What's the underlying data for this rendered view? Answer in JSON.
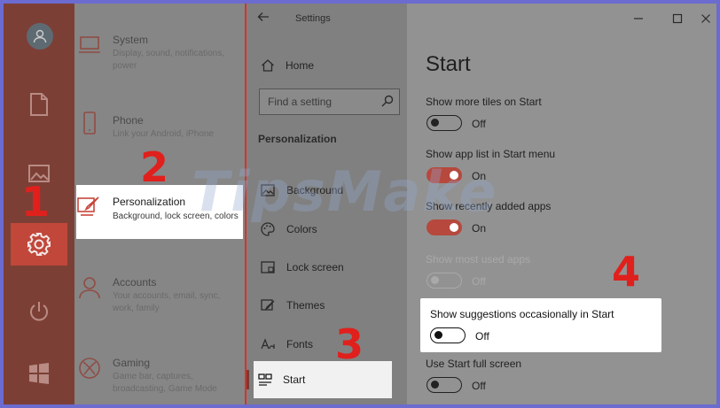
{
  "settings_window": {
    "title": "Settings",
    "home_label": "Home",
    "search_placeholder": "Find a setting",
    "section_title": "Personalization",
    "nav_items": [
      {
        "label": "Background",
        "icon": "image-icon"
      },
      {
        "label": "Colors",
        "icon": "palette-icon"
      },
      {
        "label": "Lock screen",
        "icon": "lock-screen-icon"
      },
      {
        "label": "Themes",
        "icon": "brush-icon"
      },
      {
        "label": "Fonts",
        "icon": "font-icon"
      },
      {
        "label": "Start",
        "icon": "start-layout-icon",
        "selected": true
      }
    ]
  },
  "categories": [
    {
      "title": "System",
      "desc": "Display, sound, notifications, power",
      "icon": "laptop-icon"
    },
    {
      "title": "Phone",
      "desc": "Link your Android, iPhone",
      "icon": "phone-icon"
    },
    {
      "title": "Personalization",
      "desc": "Background, lock screen, colors",
      "icon": "personalization-icon",
      "highlighted": true
    },
    {
      "title": "Accounts",
      "desc": "Your accounts, email, sync, work, family",
      "icon": "person-icon"
    },
    {
      "title": "Gaming",
      "desc": "Game bar, captures, broadcasting, Game Mode",
      "icon": "xbox-icon"
    }
  ],
  "content": {
    "page_title": "Start",
    "settings": [
      {
        "label": "Show more tiles on Start",
        "state": "Off",
        "on": false
      },
      {
        "label": "Show app list in Start menu",
        "state": "On",
        "on": true
      },
      {
        "label": "Show recently added apps",
        "state": "On",
        "on": true
      },
      {
        "label": "Show most used apps",
        "state": "Off",
        "on": false,
        "disabled": true
      },
      {
        "label": "Show suggestions occasionally in Start",
        "state": "Off",
        "on": false,
        "highlighted": true
      },
      {
        "label": "Use Start full screen",
        "state": "Off",
        "on": false
      }
    ]
  },
  "steps": [
    "1",
    "2",
    "3",
    "4"
  ],
  "watermark": "TipsMake",
  "colors": {
    "accent": "#c0473a",
    "annotation_red": "#e0201c",
    "border_purple": "#6c6bd0"
  }
}
